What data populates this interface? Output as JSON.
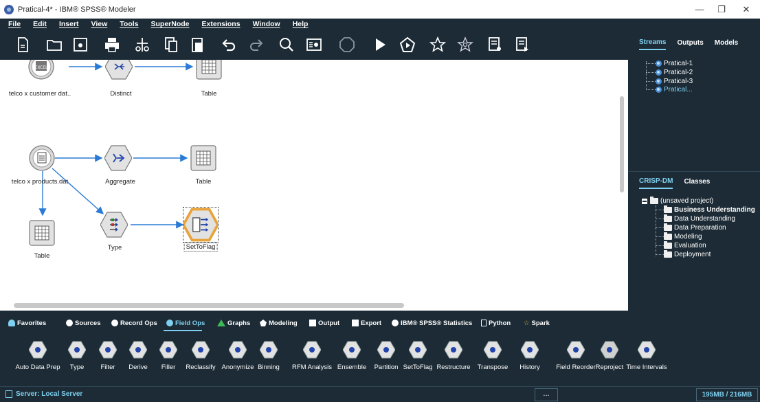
{
  "window": {
    "title": "Pratical-4* - IBM® SPSS® Modeler",
    "minimize": "—",
    "restore": "❐",
    "close": "✕"
  },
  "menu": [
    "File",
    "Edit",
    "Insert",
    "View",
    "Tools",
    "SuperNode",
    "Extensions",
    "Window",
    "Help"
  ],
  "toolbar": [
    "new-stream-icon",
    "open-stream-icon",
    "save-stream-icon",
    "print-icon",
    "cut-icon",
    "copy-icon",
    "paste-icon",
    "undo-icon",
    "redo-icon",
    "find-icon",
    "preview-icon",
    "stop-icon",
    "run-icon",
    "run-selection-icon",
    "star-icon",
    "star-settings-icon",
    "annotations-icon",
    "comments-icon"
  ],
  "canvas": {
    "nodes": {
      "excel": "telco x customer dat..",
      "distinct": "Distinct",
      "table1": "Table",
      "products": "telco x products.dat",
      "aggregate": "Aggregate",
      "table2": "Table",
      "table3": "Table",
      "type": "Type",
      "settoflag": "SetToFlag"
    }
  },
  "right_top": {
    "tabs": [
      "Streams",
      "Outputs",
      "Models"
    ],
    "active_tab": "Streams",
    "streams": [
      "Pratical-1",
      "Pratical-2",
      "Pratical-3",
      "Pratical..."
    ]
  },
  "right_bottom": {
    "tabs": [
      "CRISP-DM",
      "Classes"
    ],
    "active_tab": "CRISP-DM",
    "root": "(unsaved project)",
    "phases": [
      "Business Understanding",
      "Data Understanding",
      "Data Preparation",
      "Modeling",
      "Evaluation",
      "Deployment"
    ]
  },
  "palette": {
    "tabs": [
      "Favorites",
      "Sources",
      "Record Ops",
      "Field Ops",
      "Graphs",
      "Modeling",
      "Output",
      "Export",
      "IBM® SPSS® Statistics",
      "Python",
      "Spark"
    ],
    "active_tab": "Field Ops",
    "nodes": [
      "Auto Data Prep",
      "Type",
      "Filter",
      "Derive",
      "Filler",
      "Reclassify",
      "Anonymize",
      "Binning",
      "RFM Analysis",
      "Ensemble",
      "Partition",
      "SetToFlag",
      "Restructure",
      "Transpose",
      "History",
      "Field Reorder",
      "Reproject",
      "Time Intervals"
    ]
  },
  "status": {
    "server": "Server: Local Server",
    "dots": "...",
    "memory": "195MB / 216MB"
  },
  "colors": {
    "dark_panel": "#1c2b35",
    "accent": "#7fd0f0",
    "link_blue": "#2a7bd6",
    "node_orange": "#e8a33a"
  }
}
